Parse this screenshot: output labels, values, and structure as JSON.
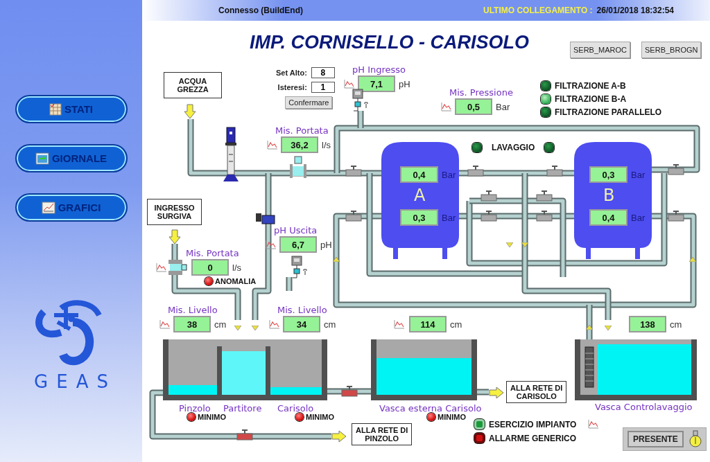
{
  "header": {
    "status": "Connesso (BuildEnd)",
    "last_label": "ULTIMO COLLEGAMENTO :",
    "last_value": "26/01/2018 18:32:54"
  },
  "sidebar": {
    "buttons": [
      {
        "label": "STATI"
      },
      {
        "label": "GIORNALE"
      },
      {
        "label": "GRAFICI"
      }
    ],
    "logo": "GEAS"
  },
  "title": "IMP. CORNISELLO - CARISOLO",
  "plant_buttons": [
    "SERB_MAROC",
    "SERB_BROGN"
  ],
  "setpoints": [
    {
      "label": "Set Alto:",
      "value": "8"
    },
    {
      "label": "Isteresi:",
      "value": "1"
    }
  ],
  "confirm_button": "Confermare",
  "sources": [
    "ACQUA\nGREZZA",
    "INGRESSO\nSURGIVA"
  ],
  "outlets": [
    "ALLA RETE DI\nCARISOLO",
    "ALLA RETE DI\nPINZOLO"
  ],
  "measures": [
    {
      "title": "pH Ingresso",
      "value": "7,1",
      "unit": "pH"
    },
    {
      "title": "Mis. Portata",
      "value": "36,2",
      "unit": "l/s"
    },
    {
      "title": "Mis. Pressione",
      "value": "0,5",
      "unit": "Bar"
    },
    {
      "title": "pH Uscita",
      "value": "6,7",
      "unit": "pH"
    },
    {
      "title": "Mis. Portata",
      "value": "0",
      "unit": "l/s"
    },
    {
      "title": "Mis. Livello",
      "value": "38",
      "unit": "cm"
    },
    {
      "title": "Mis. Livello",
      "value": "34",
      "unit": "cm"
    },
    {
      "value": "114",
      "unit": "cm"
    },
    {
      "value": "138",
      "unit": "cm"
    }
  ],
  "filters": [
    {
      "name": "A",
      "readings": [
        {
          "value": "0,4",
          "unit": "Bar"
        },
        {
          "value": "0,3",
          "unit": "Bar"
        }
      ]
    },
    {
      "name": "B",
      "readings": [
        {
          "value": "0,3",
          "unit": "Bar"
        },
        {
          "value": "0,4",
          "unit": "Bar"
        }
      ]
    }
  ],
  "filtration_modes": [
    {
      "label": "FILTRAZIONE A-B",
      "on": false
    },
    {
      "label": "FILTRAZIONE B-A",
      "on": true
    },
    {
      "label": "FILTRAZIONE PARALLELO",
      "on": false
    }
  ],
  "washing": {
    "label": "LAVAGGIO",
    "lamps": [
      {
        "on": false
      },
      {
        "on": false
      }
    ]
  },
  "anomaly": {
    "label": "ANOMALIA",
    "on": true
  },
  "tanks": [
    {
      "name": "Pinzolo",
      "alarm": {
        "label": "MINIMO",
        "on": true
      }
    },
    {
      "name": "Partitore"
    },
    {
      "name": "Carisolo",
      "alarm": {
        "label": "MINIMO",
        "on": true
      }
    },
    {
      "name": "Vasca esterna Carisolo",
      "alarm": {
        "label": "MINIMO",
        "on": true
      }
    },
    {
      "name": "Vasca Controlavaggio"
    }
  ],
  "plant_status": [
    {
      "label": "ESERCIZIO IMPIANTO",
      "on": true,
      "color": "#1a9a3a"
    },
    {
      "label": "ALLARME GENERICO",
      "on": false,
      "color": "#d01010"
    }
  ],
  "presence_button": "PRESENTE"
}
